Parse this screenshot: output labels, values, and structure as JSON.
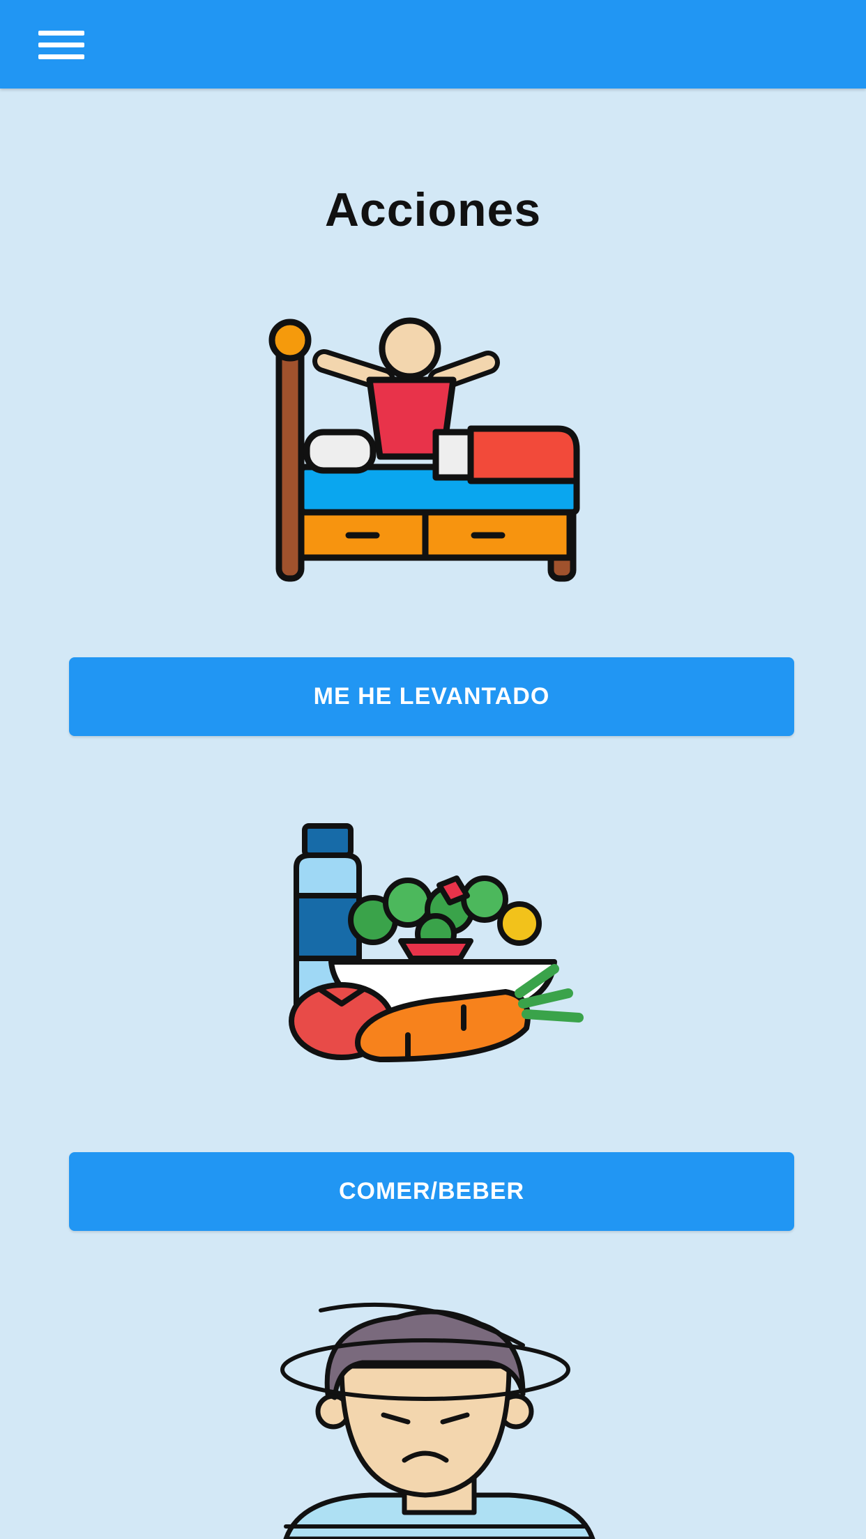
{
  "appbar": {
    "menu_icon": "hamburger-menu-icon",
    "color": "#2196f3"
  },
  "page": {
    "title": "Acciones",
    "background": "#d3e8f6"
  },
  "actions": [
    {
      "icon": "wake-up-bed-icon",
      "label": "ME HE LEVANTADO"
    },
    {
      "icon": "food-drink-icon",
      "label": "COMER/BEBER"
    },
    {
      "icon": "dizzy-person-icon",
      "label": ""
    }
  ],
  "colors": {
    "button": "#2196f3",
    "button_text": "#ffffff"
  }
}
